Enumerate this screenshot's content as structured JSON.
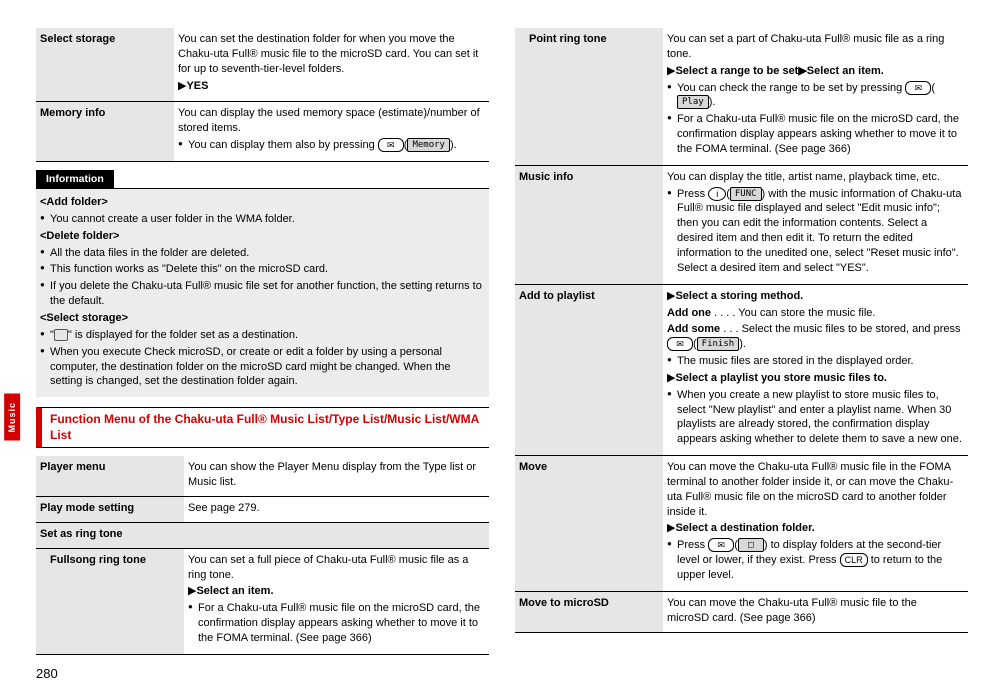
{
  "page_number": "280",
  "side_tab": "Music",
  "left": {
    "rows": {
      "select_storage": {
        "label": "Select storage",
        "desc": "You can set the destination folder for when you move the Chaku-uta Full® music file to the microSD card. You can set it for up to seventh-tier-level folders.",
        "yes": "YES"
      },
      "memory_info": {
        "label": "Memory info",
        "desc": "You can display the used memory space (estimate)/number of stored items.",
        "bullet": "You can display them also by pressing ",
        "key1": "✉",
        "keylabel": "Memory",
        "bullet_tail": ")."
      }
    },
    "info": {
      "header": "Information",
      "add_folder_h": "<Add folder>",
      "add_folder_b": "You cannot create a user folder in the WMA folder.",
      "delete_folder_h": "<Delete folder>",
      "delete_b1": "All the data files in the folder are deleted.",
      "delete_b2": "This function works as \"Delete this\" on the microSD card.",
      "delete_b3": "If you delete the Chaku-uta Full® music file set for another function, the setting returns to the default.",
      "select_storage_h": "<Select storage>",
      "select_b1_pre": "\"",
      "select_b1_post": "\" is displayed for the folder set as a destination.",
      "select_b2": "When you execute Check microSD, or create or edit a folder by using a personal computer, the destination folder on the microSD card might be changed. When the setting is changed, set the destination folder again."
    },
    "menu_header": "Function Menu of the Chaku-uta Full® Music List/Type List/Music List/WMA List",
    "rows2": {
      "player_menu": {
        "label": "Player menu",
        "desc": "You can show the Player Menu display from the Type list or Music list."
      },
      "play_mode": {
        "label": "Play mode setting",
        "desc": "See page 279."
      },
      "set_ring": {
        "label": "Set as ring tone"
      },
      "fullsong": {
        "label": "Fullsong ring tone",
        "desc1": "You can set a full piece of Chaku-uta Full® music file as a ring tone.",
        "step": "Select an item.",
        "bullet": "For a Chaku-uta Full® music file on the microSD card, the confirmation display appears asking whether to move it to the FOMA terminal. (See page 366)"
      }
    }
  },
  "right": {
    "point_ring": {
      "label": "Point ring tone",
      "desc1": "You can set a part of Chaku-uta Full® music file as a ring tone.",
      "step": "Select a range to be set▶Select an item.",
      "b1_pre": "You can check the range to be set by pressing ",
      "b1_key": "✉",
      "b1_keylabel": "Play",
      "b1_post": ").",
      "b2": "For a Chaku-uta Full® music file on the microSD card, the confirmation display appears asking whether to move it to the FOMA terminal. (See page 366)"
    },
    "music_info": {
      "label": "Music info",
      "desc1": "You can display the title, artist name, playback time, etc.",
      "b1_pre": "Press ",
      "b1_key": "i",
      "b1_keylabel": "FUNC",
      "b1_post": ") with the music information of Chaku-uta Full® music file displayed and select \"Edit music info\"; then you can edit the information contents. Select a desired item and then edit it. To return the edited information to the unedited one, select \"Reset music info\". Select a desired item and select \"YES\"."
    },
    "add_playlist": {
      "label": "Add to playlist",
      "step1": "Select a storing method.",
      "addone_l": "Add one",
      "addone_d": " . . . .  You can store the music file.",
      "addsome_l": "Add some",
      "addsome_d": " . . .  Select the music files to be stored, and press ",
      "addsome_key": "✉",
      "addsome_keylabel": "Finish",
      "addsome_post": ").",
      "b1": "The music files are stored in the displayed order.",
      "step2": "Select a playlist you store music files to.",
      "b2": "When you create a new playlist to store music files to, select \"New playlist\" and enter a playlist name. When 30 playlists are already stored, the confirmation display appears asking whether to delete them to save a new one."
    },
    "move": {
      "label": "Move",
      "desc1": "You can move the Chaku-uta Full® music file in the FOMA terminal to another folder inside it, or can move the Chaku-uta Full® music file on the microSD card to another folder inside it.",
      "step": "Select a destination folder.",
      "b1_pre": "Press ",
      "b1_key": "✉",
      "b1_keylabel": "□",
      "b1_mid": ") to display folders at the second-tier level or lower, if they exist. Press ",
      "b1_key2": "CLR",
      "b1_post": " to return to the upper level."
    },
    "move_micro": {
      "label": "Move to microSD",
      "desc": "You can move the Chaku-uta Full® music file to the microSD card. (See page 366)"
    }
  }
}
